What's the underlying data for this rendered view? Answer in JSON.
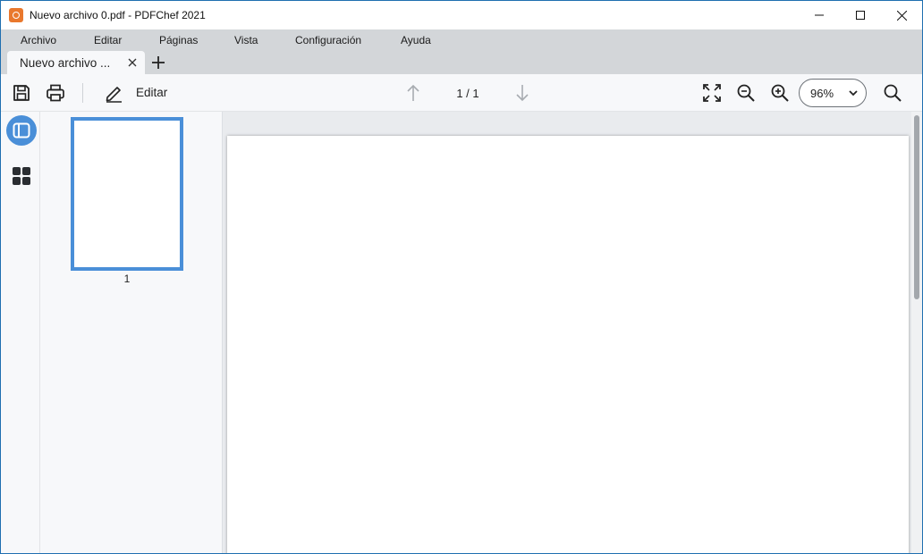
{
  "window": {
    "title": "Nuevo archivo 0.pdf - PDFChef 2021",
    "accent_color": "#4a8fd8"
  },
  "menu": {
    "items": [
      {
        "label": "Archivo"
      },
      {
        "label": "Editar"
      },
      {
        "label": "Páginas"
      },
      {
        "label": "Vista"
      },
      {
        "label": "Configuración"
      },
      {
        "label": "Ayuda"
      }
    ]
  },
  "tabs": {
    "active_label": "Nuevo archivo ..."
  },
  "toolbar": {
    "edit_label": "Editar",
    "page_indicator": "1 / 1",
    "zoom_value": "96%"
  },
  "thumbnails": {
    "items": [
      {
        "page_number": "1"
      }
    ]
  }
}
